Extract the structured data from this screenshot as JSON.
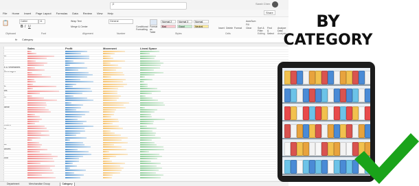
{
  "headline": {
    "line1": "BY",
    "line2": "CATEGORY"
  },
  "excel": {
    "menu": [
      "File",
      "Home",
      "Insert",
      "Page Layout",
      "Formulas",
      "Data",
      "Review",
      "View",
      "Help"
    ],
    "user_name": "Sarah Chen",
    "share_label": "Share",
    "search_placeholder": "Search",
    "ribbon": {
      "font": "Calibri",
      "font_size": "11",
      "wrap_text": "Wrap Text",
      "merge_center": "Merge & Center",
      "number_format": "General",
      "conditional_formatting": "Conditional Formatting",
      "format_as_table": "Format as Table",
      "styles": [
        {
          "label": "Normal 2",
          "bg": "#ffffff"
        },
        {
          "label": "Normal 3",
          "bg": "#ffffff"
        },
        {
          "label": "Normal",
          "bg": "#ffffff"
        },
        {
          "label": "Bad",
          "bg": "#ffc7ce"
        },
        {
          "label": "Good",
          "bg": "#c6efce"
        },
        {
          "label": "Neutral",
          "bg": "#ffeb9c"
        }
      ],
      "insert": "Insert",
      "delete": "Delete",
      "format": "Format",
      "autosum": "AutoSum",
      "fill": "Fill",
      "clear": "Clear",
      "sort_filter": "Sort & Filter",
      "find_select": "Find & Select",
      "analyze_data": "Analyze Data",
      "groups": [
        "Clipboard",
        "Font",
        "Alignment",
        "Number",
        "Styles",
        "Cells",
        "Editing",
        "Analysis"
      ]
    },
    "formula_bar": {
      "fx": "fx",
      "value": "Category"
    },
    "columns": [
      {
        "title": "Sales",
        "color": "#f28b8b"
      },
      {
        "title": "Profit",
        "color": "#5b9bd5"
      },
      {
        "title": "Movement",
        "color": "#f7c26b"
      },
      {
        "title": "Lineal Space",
        "color": "#8fce9a"
      }
    ],
    "row_labels": [
      "er",
      "s & Vegetables",
      "Beverages",
      "ts",
      "ies",
      "ts",
      "gene",
      "orates",
      "al",
      "es",
      "ances",
      "ood"
    ],
    "sheet_tabs": [
      "Department",
      "Merchandise Group",
      "Category"
    ],
    "active_tab": "Category"
  }
}
